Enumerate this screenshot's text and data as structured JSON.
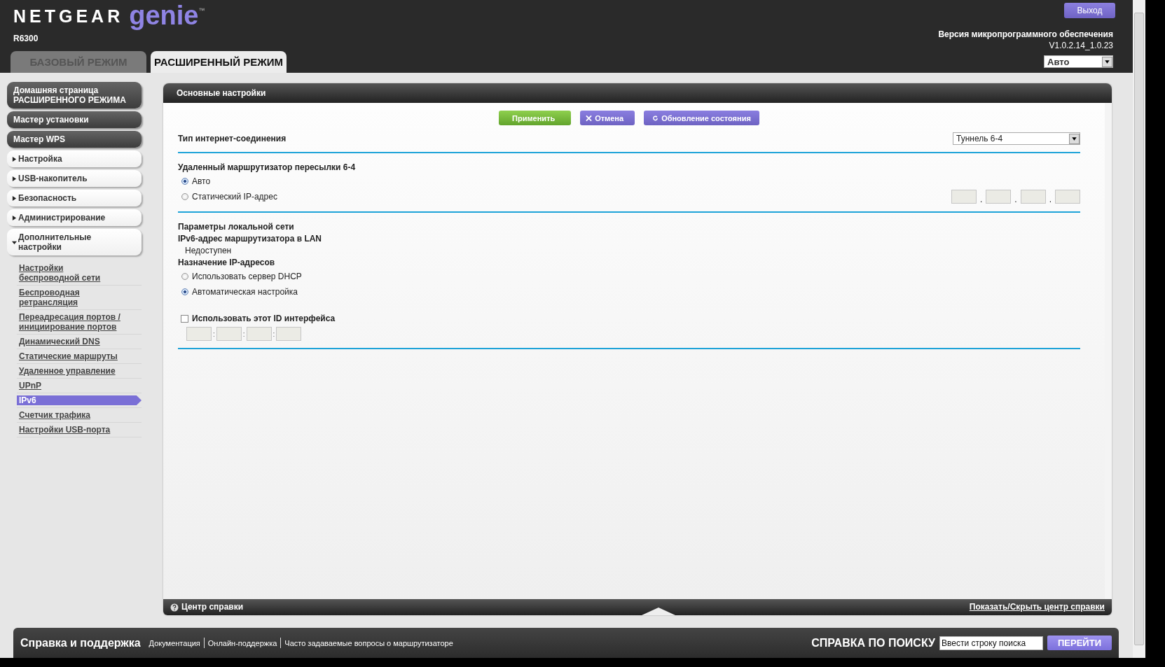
{
  "header": {
    "brand": "NETGEAR",
    "product": "genie",
    "trademark": "™",
    "model": "R6300",
    "logout": "Выход",
    "firmware_label": "Версия микропрограммного обеспечения",
    "firmware_version": "V1.0.2.14_1.0.23",
    "language": "Авто"
  },
  "mode_tabs": [
    {
      "label": "БАЗОВЫЙ РЕЖИМ",
      "selected": false
    },
    {
      "label": "РАСШИРЕННЫЙ РЕЖИМ",
      "selected": true
    }
  ],
  "sidebar": {
    "items": [
      {
        "label": "Домашняя страница РАСШИРЕННОГО РЕЖИМА",
        "kind": "primary"
      },
      {
        "label": "Мастер установки",
        "kind": "primary"
      },
      {
        "label": "Мастер WPS",
        "kind": "primary"
      },
      {
        "label": "Настройка",
        "kind": "section",
        "expanded": false
      },
      {
        "label": "USB-накопитель",
        "kind": "section",
        "expanded": false
      },
      {
        "label": "Безопасность",
        "kind": "section",
        "expanded": false
      },
      {
        "label": "Администрирование",
        "kind": "section",
        "expanded": false
      },
      {
        "label": "Дополнительные настройки",
        "kind": "section",
        "expanded": true,
        "children": [
          {
            "label": "Настройки беспроводной сети",
            "selected": false
          },
          {
            "label": "Беспроводная ретрансляция",
            "selected": false
          },
          {
            "label": "Переадресация портов / инициирование портов",
            "selected": false
          },
          {
            "label": "Динамический DNS",
            "selected": false
          },
          {
            "label": "Статические маршруты",
            "selected": false
          },
          {
            "label": "Удаленное управление",
            "selected": false
          },
          {
            "label": "UPnP",
            "selected": false
          },
          {
            "label": "IPv6",
            "selected": true
          },
          {
            "label": "Счетчик трафика",
            "selected": false
          },
          {
            "label": "Настройки USB-порта",
            "selected": false
          }
        ]
      }
    ]
  },
  "panel": {
    "title": "Основные настройки",
    "buttons": [
      {
        "label": "Применить",
        "kind": "apply"
      },
      {
        "label": "Отмена",
        "kind": "cancel"
      },
      {
        "label": "Обновление состояния",
        "kind": "refresh"
      }
    ],
    "connection_type": {
      "label": "Тип интернет-соединения",
      "value": "Туннель 6-4"
    },
    "relay": {
      "label": "Удаленный маршрутизатор пересылки 6-4",
      "ip_separator": ".",
      "options": [
        {
          "label": "Авто",
          "selected": true
        },
        {
          "label": "Статический IP-адрес",
          "selected": false
        }
      ]
    },
    "lan": {
      "heading": "Параметры локальной сети",
      "address_label": "IPv6-адрес маршрутизатора в LAN",
      "address_value": "Недоступен",
      "assignment_label": "Назначение IP-адресов",
      "options": [
        {
          "label": "Использовать сервер DHCP",
          "selected": false
        },
        {
          "label": "Автоматическая настройка",
          "selected": true
        }
      ]
    },
    "interface_id": {
      "label": "Использовать этот ID интерфейса",
      "checked": false,
      "separator": ":"
    }
  },
  "help_bar": {
    "title": "Центр справки",
    "toggle": "Показать/Скрыть центр справки"
  },
  "footer": {
    "title": "Справка и поддержка",
    "links": [
      "Документация",
      "Онлайн-поддержка",
      "Часто задаваемые вопросы о маршрутизаторе"
    ],
    "search_label": "СПРАВКА ПО ПОИСКУ",
    "search_placeholder": "Ввести строку поиска",
    "go": "ПЕРЕЙТИ"
  }
}
